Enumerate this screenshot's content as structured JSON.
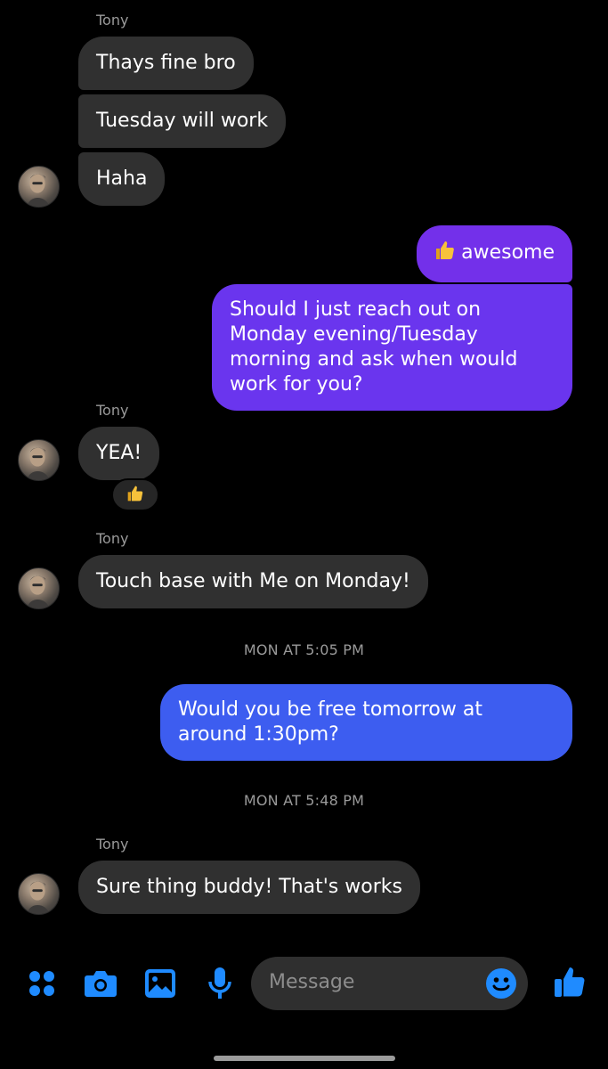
{
  "colors": {
    "incoming_bubble": "#303030",
    "outgoing_purple": "#7330ea",
    "outgoing_violet": "#6a35ee",
    "outgoing_blue": "#3d5df0",
    "accent_blue": "#1f8bff",
    "meta_text": "#9a9a9a"
  },
  "messages": [
    {
      "sender": "Tony",
      "text": "Thays fine bro"
    },
    {
      "text": "Tuesday will work"
    },
    {
      "text": "Haha"
    },
    {
      "text": "awesome",
      "emoji": "thumbs-up"
    },
    {
      "text": "Should I just reach out on Monday evening/Tuesday morning and ask when would work for you?"
    },
    {
      "sender": "Tony",
      "text": "YEA!",
      "reaction": "thumbs-up"
    },
    {
      "sender": "Tony",
      "text": "Touch base with Me on Monday!"
    },
    {
      "timestamp": "MON AT 5:05 PM"
    },
    {
      "text": "Would you be free tomorrow at around 1:30pm?"
    },
    {
      "timestamp": "MON AT 5:48 PM"
    },
    {
      "sender": "Tony",
      "text": "Sure thing buddy! That's works"
    }
  ],
  "composer": {
    "placeholder": "Message",
    "icons": [
      "apps-icon",
      "camera-icon",
      "gallery-icon",
      "microphone-icon",
      "emoji-icon",
      "like-icon"
    ]
  }
}
